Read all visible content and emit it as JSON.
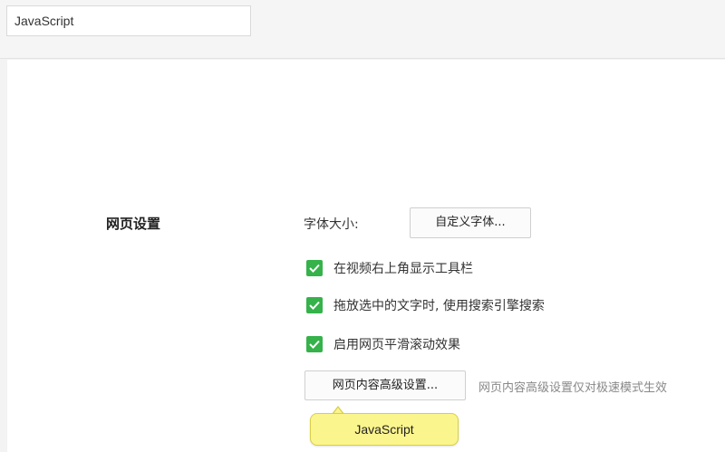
{
  "search": {
    "value": "JavaScript"
  },
  "settings": {
    "section_title": "网页设置",
    "font_size_label": "字体大小:",
    "custom_font_button": "自定义字体...",
    "checkboxes": [
      {
        "label": "在视频右上角显示工具栏",
        "checked": true
      },
      {
        "label": "拖放选中的文字时, 使用搜索引擎搜索",
        "checked": true
      },
      {
        "label": "启用网页平滑滚动效果",
        "checked": true
      }
    ],
    "advanced_button": "网页内容高级设置...",
    "advanced_hint": "网页内容高级设置仅对极速模式生效"
  },
  "tooltip": {
    "text": "JavaScript"
  },
  "colors": {
    "check_green": "#35b24a",
    "tooltip_yellow": "#fbf58e"
  }
}
